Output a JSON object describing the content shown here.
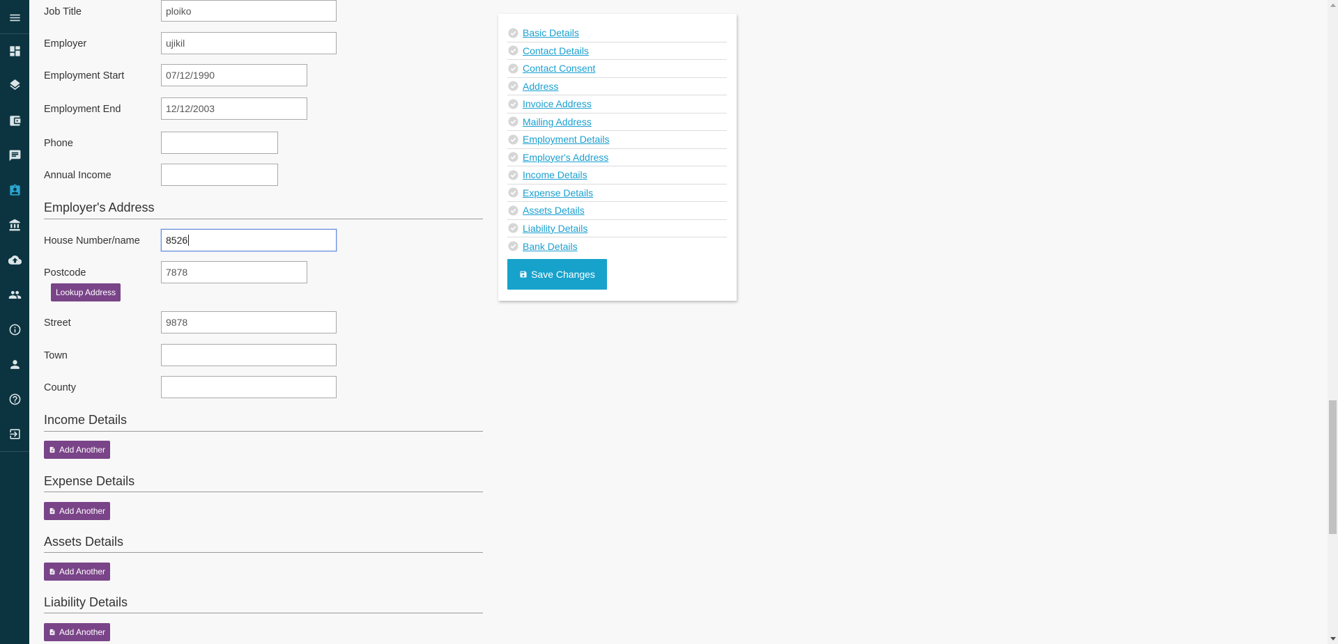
{
  "sidebar": {
    "items": [
      {
        "icon": "menu-icon"
      },
      {
        "icon": "dashboard-icon"
      },
      {
        "icon": "layers-icon"
      },
      {
        "icon": "wallet-icon"
      },
      {
        "icon": "message-icon"
      },
      {
        "icon": "contact-card-icon",
        "active": true
      },
      {
        "icon": "bank-icon"
      },
      {
        "icon": "cloud-upload-icon"
      },
      {
        "icon": "people-icon"
      },
      {
        "icon": "info-icon"
      },
      {
        "icon": "person-icon"
      },
      {
        "icon": "help-icon"
      },
      {
        "icon": "logout-icon"
      }
    ]
  },
  "employment": {
    "job_title": {
      "label": "Job Title",
      "value": "ploiko"
    },
    "employer": {
      "label": "Employer",
      "value": "ujikil"
    },
    "start": {
      "label": "Employment Start",
      "value": "07/12/1990"
    },
    "end": {
      "label": "Employment End",
      "value": "12/12/2003"
    },
    "phone": {
      "label": "Phone",
      "value": ""
    },
    "income": {
      "label": "Annual Income",
      "value": ""
    }
  },
  "employers_address": {
    "title": "Employer's Address",
    "house": {
      "label": "House Number/name",
      "value": "8526"
    },
    "postcode": {
      "label": "Postcode",
      "value": "7878"
    },
    "lookup_label": "Lookup Address",
    "street": {
      "label": "Street",
      "value": "9878"
    },
    "town": {
      "label": "Town",
      "value": ""
    },
    "county": {
      "label": "County",
      "value": ""
    }
  },
  "sections": [
    {
      "title": "Income Details",
      "button": "Add Another"
    },
    {
      "title": "Expense Details",
      "button": "Add Another"
    },
    {
      "title": "Assets Details",
      "button": "Add Another"
    },
    {
      "title": "Liability Details",
      "button": "Add Another"
    }
  ],
  "panel": {
    "links": [
      "Basic Details",
      "Contact Details",
      "Contact Consent",
      "Address",
      "Invoice Address",
      "Mailing Address",
      "Employment Details",
      "Employer's Address",
      "Income Details",
      "Expense Details",
      "Assets Details",
      "Liability Details",
      "Bank Details"
    ],
    "save_label": "Save Changes"
  },
  "colors": {
    "sidebar_bg": "#0c3440",
    "active_icon": "#29a7d1",
    "purple_button": "#7a4488",
    "save_button": "#17a2cc",
    "link": "#1a9fd0"
  }
}
